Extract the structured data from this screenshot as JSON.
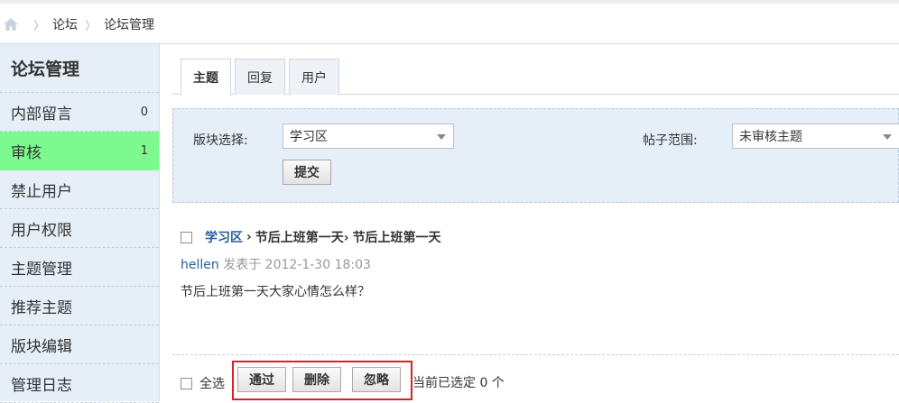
{
  "breadcrumb": {
    "items": [
      "论坛",
      "论坛管理"
    ]
  },
  "sidebar": {
    "title": "论坛管理",
    "items": [
      {
        "label": "内部留言",
        "count": "0"
      },
      {
        "label": "审核",
        "count": "1"
      },
      {
        "label": "禁止用户",
        "count": ""
      },
      {
        "label": "用户权限",
        "count": ""
      },
      {
        "label": "主题管理",
        "count": ""
      },
      {
        "label": "推荐主题",
        "count": ""
      },
      {
        "label": "版块编辑",
        "count": ""
      },
      {
        "label": "管理日志",
        "count": ""
      }
    ],
    "active_index": 1,
    "active_color": "#7cfa8f"
  },
  "tabs": [
    "主题",
    "回复",
    "用户"
  ],
  "filter": {
    "board_label": "版块选择:",
    "board_value": "学习区",
    "range_label": "帖子范围:",
    "range_value": "未审核主题",
    "submit_label": "提交"
  },
  "post": {
    "forum": "学习区",
    "title_part1": "节后上班第一天›",
    "title_part2": "节后上班第一天",
    "author": "hellen",
    "posted_prefix": "发表于",
    "date": "2012-1-30 18:03",
    "body": "节后上班第一天大家心情怎么样？"
  },
  "actions": {
    "select_all": "全选",
    "approve": "通过",
    "delete": "删除",
    "ignore": "忽略",
    "status": "当前已选定 0 个"
  },
  "colors": {
    "link": "#2a5d9a",
    "highlight_box": "#d9212b",
    "panel_bg": "#e6eef7"
  }
}
